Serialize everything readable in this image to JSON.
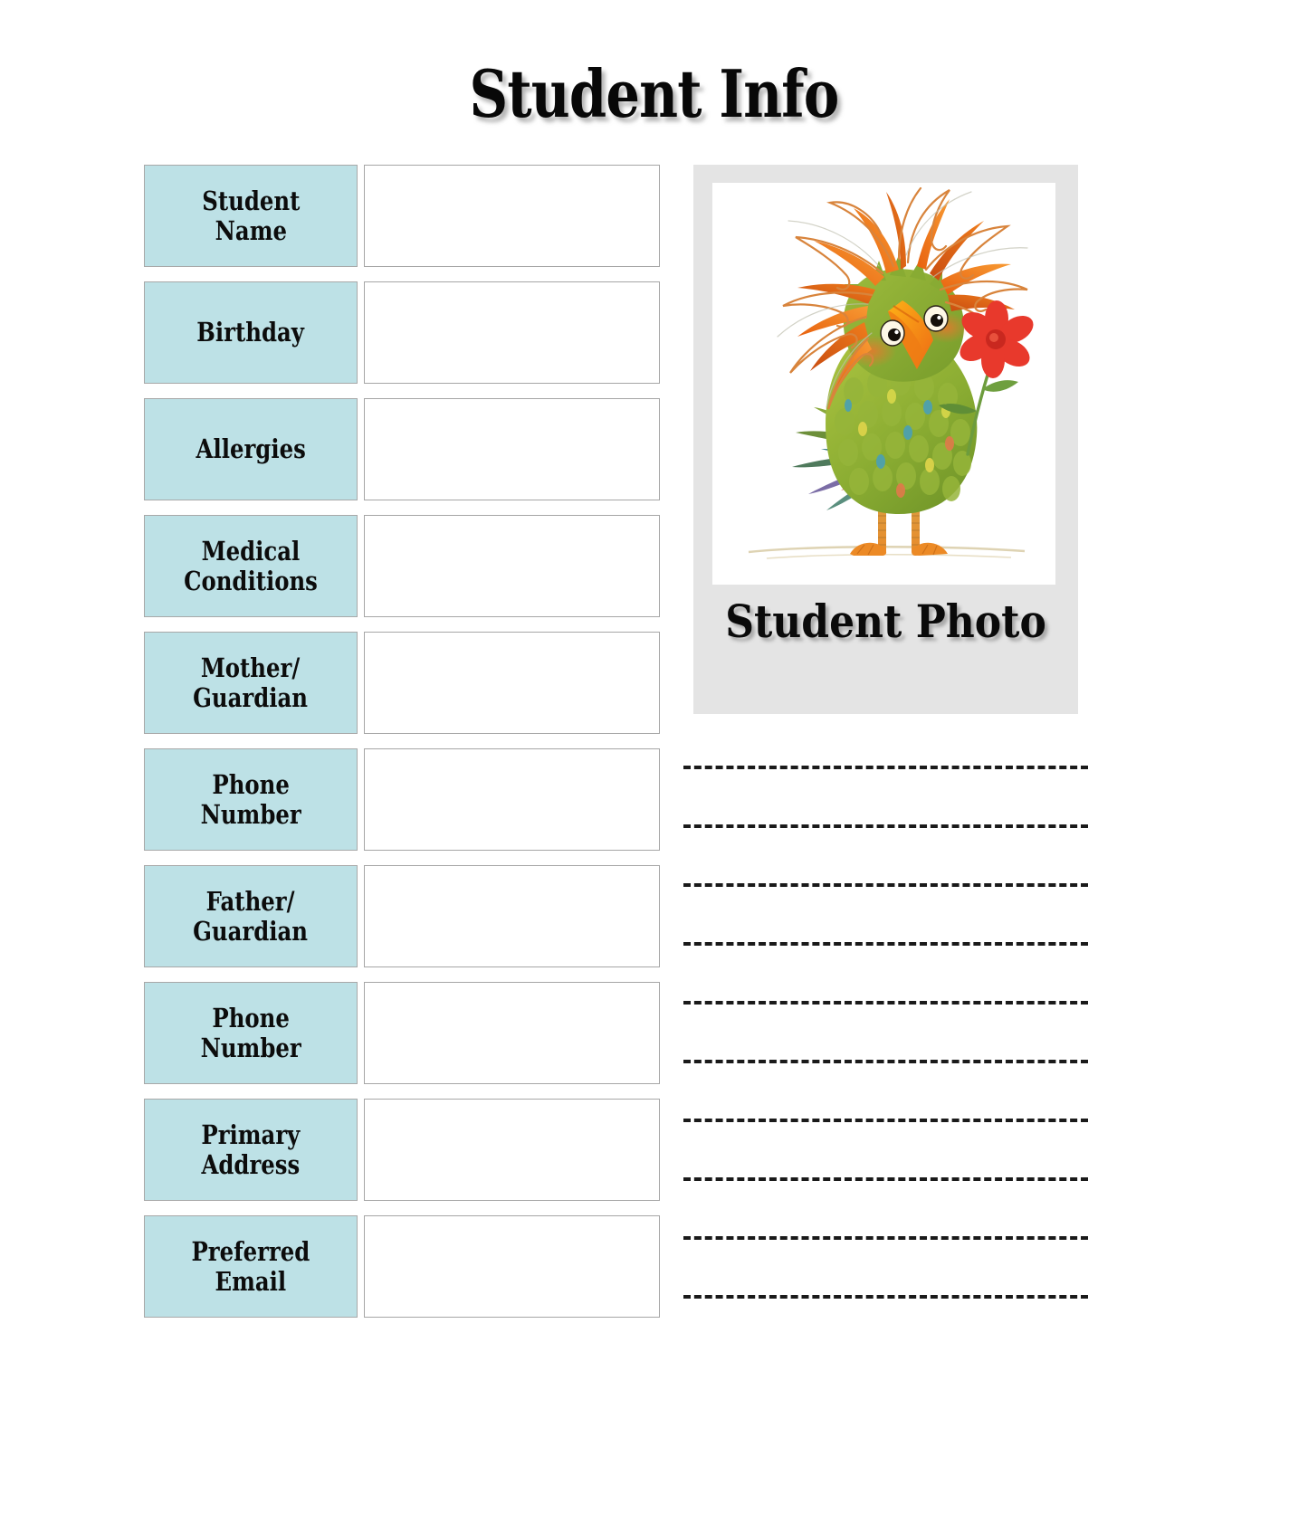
{
  "page": {
    "title": "Student Info",
    "background_color": "#ffffff"
  },
  "colors": {
    "label_fill": "#bde1e6",
    "label_border": "#a8a8a8",
    "input_border": "#a6a6a6",
    "photo_card_fill": "#e4e4e4",
    "text": "#0c0c0c",
    "line_color": "#1a1a1a"
  },
  "form": {
    "rows": [
      {
        "label": "Student\nName",
        "value": ""
      },
      {
        "label": "Birthday",
        "value": ""
      },
      {
        "label": "Allergies",
        "value": ""
      },
      {
        "label": "Medical\nConditions",
        "value": ""
      },
      {
        "label": "Mother/\nGuardian",
        "value": ""
      },
      {
        "label": "Phone\nNumber",
        "value": ""
      },
      {
        "label": "Father/\nGuardian",
        "value": ""
      },
      {
        "label": "Phone\nNumber",
        "value": ""
      },
      {
        "label": "Primary\nAddress",
        "value": ""
      },
      {
        "label": "Preferred\nEmail",
        "value": ""
      }
    ]
  },
  "photo": {
    "caption": "Student Photo",
    "illustration": "whimsical-bird-with-red-flower"
  },
  "notes": {
    "line_count": 10
  }
}
